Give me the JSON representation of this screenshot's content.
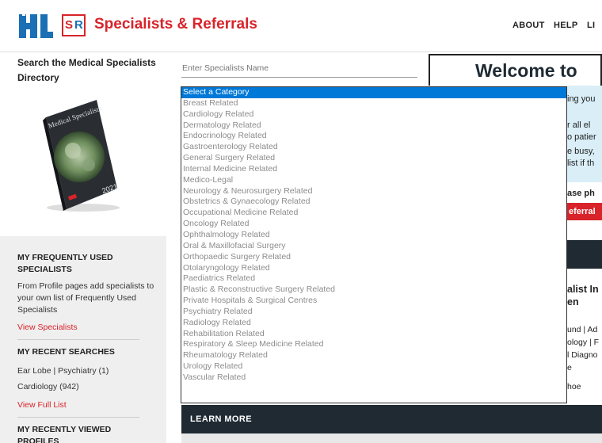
{
  "header": {
    "logo_left": "HL",
    "logo_right_s": "S",
    "logo_right_r": "R",
    "title": "Specialists & Referrals",
    "nav": [
      "ABOUT",
      "HELP",
      "LI"
    ]
  },
  "sidebar": {
    "search_title": "Search the Medical Specialists Directory",
    "book": {
      "title": "Medical Specialists",
      "year": "2021"
    },
    "frequent_heading": "MY FREQUENTLY USED SPECIALISTS",
    "frequent_text": "From Profile pages add specialists to your own list of Frequently Used Specialists",
    "frequent_link": "View Specialists",
    "recent_heading": "MY RECENT SEARCHES",
    "recent_searches": [
      "Ear Lobe | Psychiatry (1)",
      "Cardiology (942)"
    ],
    "recent_link": "View Full List",
    "viewed_heading": "MY RECENTLY VIEWED PROFILES"
  },
  "search": {
    "name_placeholder": "Enter Specialists Name"
  },
  "category_dropdown": {
    "selected": "Select a Category",
    "options": [
      "Select a Category",
      "Breast Related",
      "Cardiology Related",
      "Dermatology Related",
      "Endocrinology Related",
      "Gastroenterology Related",
      "General Surgery Related",
      "Internal Medicine Related",
      "Medico-Legal",
      "Neurology & Neurosurgery Related",
      "Obstetrics & Gynaecology Related",
      "Occupational Medicine Related",
      "Oncology Related",
      "Ophthalmology Related",
      "Oral & Maxillofacial Surgery",
      "Orthopaedic Surgery Related",
      "Otolaryngology Related",
      "Paediatrics Related",
      "Plastic & Reconstructive Surgery Related",
      "Private Hospitals & Surgical Centres",
      "Psychiatry Related",
      "Radiology Related",
      "Rehabilitation Related",
      "Respiratory & Sleep Medicine Related",
      "Rheumatology Related",
      "Urology Related",
      "Vascular Related"
    ]
  },
  "welcome": {
    "title": "Welcome to",
    "fragments": [
      "ing you",
      "r all el",
      "o patier",
      "e busy,",
      "list if th",
      "ase ph",
      "eferral"
    ]
  },
  "specialist_section": {
    "heading_lines": [
      "alist In",
      "en"
    ],
    "text_lines": [
      "und | Ad",
      "ology | F",
      "l Diagno",
      "e",
      "hoe"
    ]
  },
  "learn_more": "LEARN MORE",
  "colors": {
    "brand_red": "#d8232a",
    "brand_blue": "#1a6fb5",
    "dark_navy": "#1f2a33",
    "selection_blue": "#0078d7",
    "light_blue": "#d9eef7"
  }
}
